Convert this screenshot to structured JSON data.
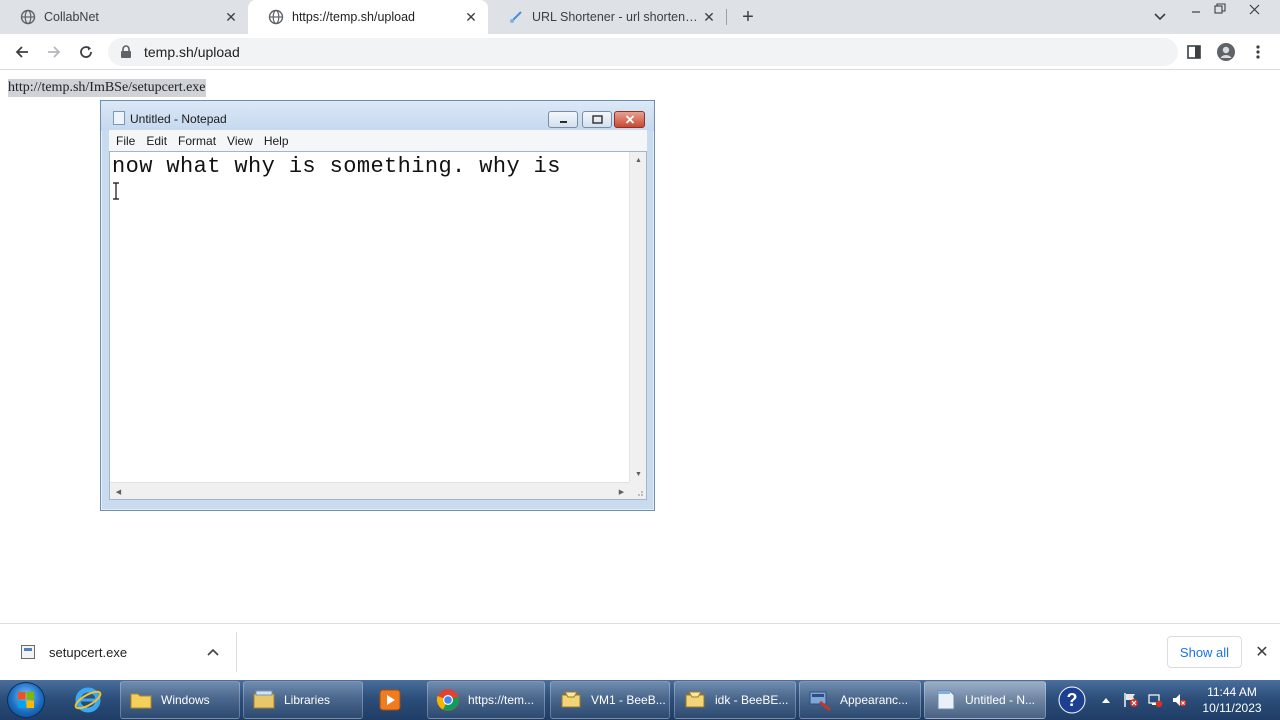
{
  "browser": {
    "tabs": [
      {
        "title": "CollabNet",
        "active": false
      },
      {
        "title": "https://temp.sh/upload",
        "active": true
      },
      {
        "title": "URL Shortener - url shortening se",
        "active": false
      }
    ],
    "address": "temp.sh/upload"
  },
  "page": {
    "link_text": "http://temp.sh/ImBSe/setupcert.exe"
  },
  "notepad": {
    "title": "Untitled - Notepad",
    "menu": [
      "File",
      "Edit",
      "Format",
      "View",
      "Help"
    ],
    "content": "now what why is something. why is"
  },
  "downloads": {
    "filename": "setupcert.exe",
    "show_all_label": "Show all"
  },
  "taskbar": {
    "items": [
      {
        "label": "Windows"
      },
      {
        "label": "Libraries"
      },
      {
        "label": "https://tem..."
      },
      {
        "label": "VM1 - BeeB..."
      },
      {
        "label": "idk - BeeBE..."
      },
      {
        "label": "Appearanc..."
      },
      {
        "label": "Untitled - N..."
      }
    ],
    "clock_time": "11:44 AM",
    "clock_date": "10/11/2023"
  }
}
